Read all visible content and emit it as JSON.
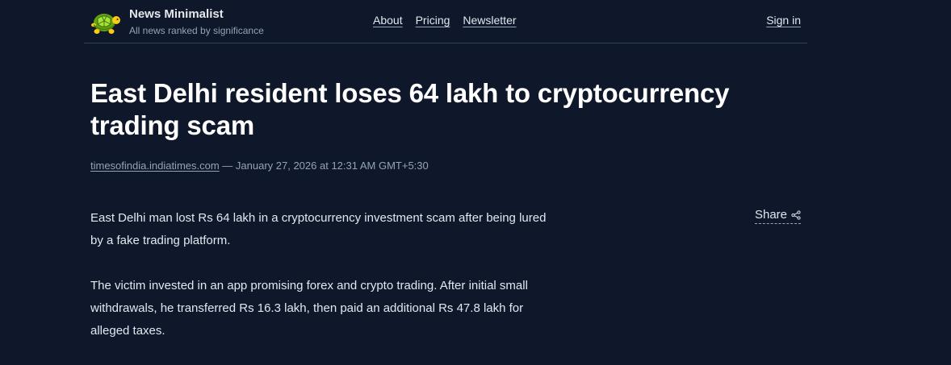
{
  "brand": {
    "name": "News Minimalist",
    "tagline": "All news ranked by significance"
  },
  "nav": {
    "items": [
      "About",
      "Pricing",
      "Newsletter"
    ],
    "signin": "Sign in"
  },
  "article": {
    "title": "East Delhi resident loses 64 lakh to cryptocurrency trading scam",
    "source": "timesofindia.indiatimes.com",
    "date_text": " — January 27, 2026 at 12:31 AM GMT+5:30",
    "paragraphs": [
      "East Delhi man lost Rs 64 lakh in a cryptocurrency investment scam after being lured by a fake trading platform.",
      "The victim invested in an app promising forex and crypto trading. After initial small withdrawals, he transferred Rs 16.3 lakh, then paid an additional Rs 47.8 lakh for alleged taxes."
    ]
  },
  "share": {
    "label": "Share",
    "icon": "share-icon"
  },
  "colors": {
    "background": "#0f172a",
    "text": "#e2e8f0",
    "muted": "#94a3b8",
    "divider": "#334155"
  }
}
